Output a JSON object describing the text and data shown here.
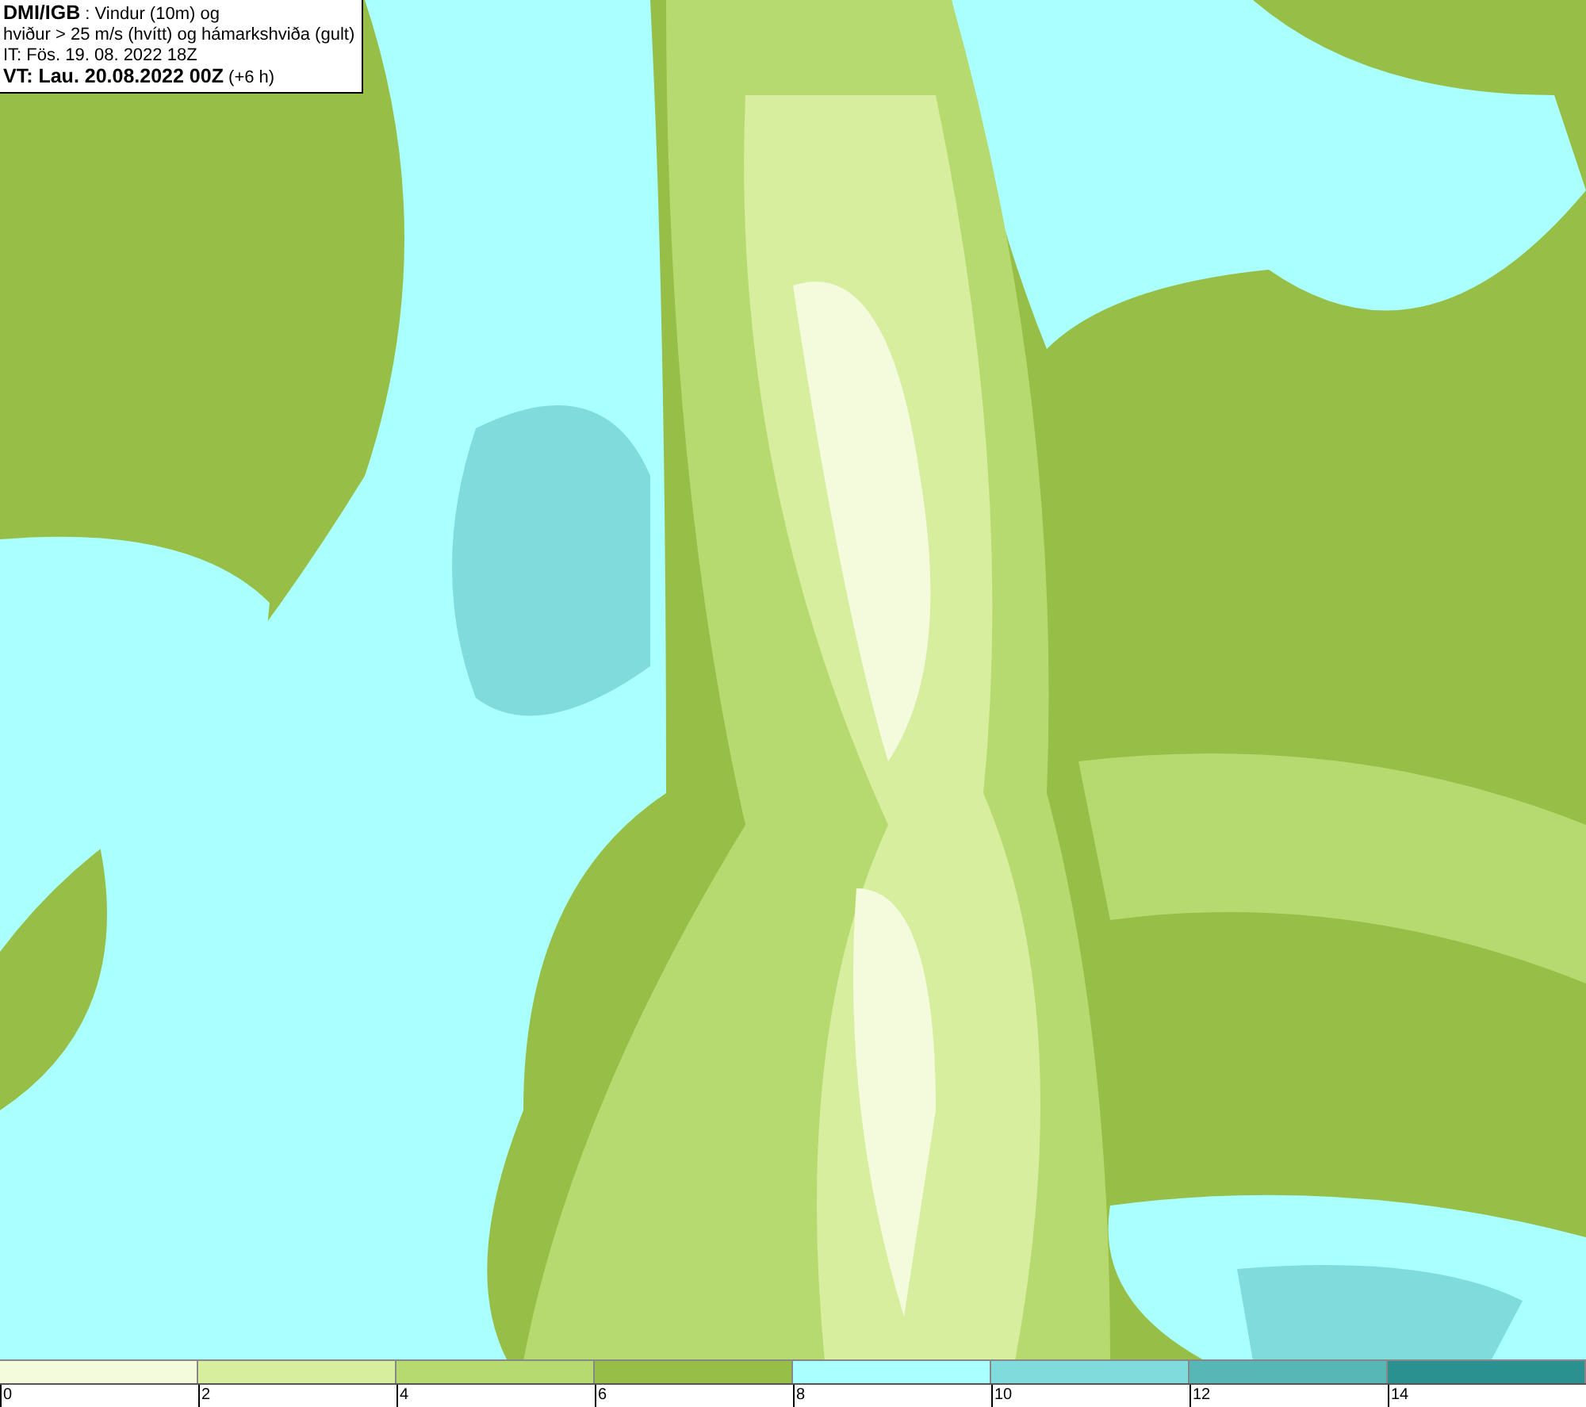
{
  "title_box": {
    "lines": [
      "**DMI/IGB** : Vindur (10m) og",
      "hviður > 25 m/s (hvítt) og hámarkshviða (gult)",
      "IT: Fös. 19. 08. 2022 18Z",
      "**VT: Lau. 20.08.2022 00Z** (+6 h)"
    ]
  },
  "legend": {
    "bins": [
      {
        "color": "#f4fbdc"
      },
      {
        "color": "#d6ee9e"
      },
      {
        "color": "#b6da70"
      },
      {
        "color": "#97bf47"
      },
      {
        "color": "#aaffff"
      },
      {
        "color": "#80dcdc"
      },
      {
        "color": "#57b6b6"
      },
      {
        "color": "#2a9090"
      }
    ],
    "ticks": [
      "0",
      "2",
      "4",
      "6",
      "8",
      "10",
      "12",
      "14"
    ]
  }
}
